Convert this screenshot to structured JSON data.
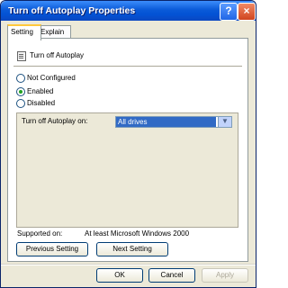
{
  "window": {
    "title": "Turn off Autoplay Properties",
    "help_label": "?",
    "close_label": "×"
  },
  "tabs": [
    {
      "label": "Setting",
      "active": true
    },
    {
      "label": "Explain",
      "active": false
    }
  ],
  "setting": {
    "name": "Turn off Autoplay",
    "radios": [
      {
        "label": "Not Configured",
        "selected": false
      },
      {
        "label": "Enabled",
        "selected": true
      },
      {
        "label": "Disabled",
        "selected": false
      }
    ],
    "option_label": "Turn off Autoplay on:",
    "option_value": "All drives",
    "supported_label": "Supported on:",
    "supported_value": "At least Microsoft Windows 2000"
  },
  "nav_buttons": {
    "previous": "Previous Setting",
    "next": "Next Setting"
  },
  "dialog_buttons": {
    "ok": "OK",
    "cancel": "Cancel",
    "apply": "Apply"
  },
  "colors": {
    "titlebar": "#0a5ad8",
    "selection": "#316ac5",
    "face": "#ece9d8"
  }
}
